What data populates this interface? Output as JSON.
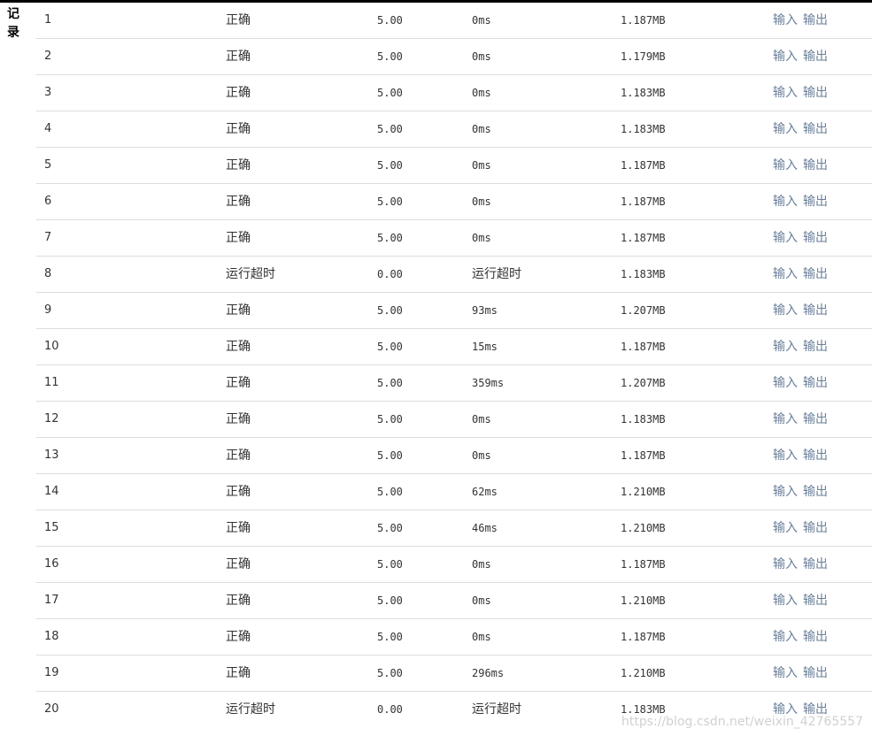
{
  "side_label": "记录",
  "rows": [
    {
      "id": "1",
      "result": "正确",
      "score": "5.00",
      "time": "0ms",
      "memory": "1.187MB"
    },
    {
      "id": "2",
      "result": "正确",
      "score": "5.00",
      "time": "0ms",
      "memory": "1.179MB"
    },
    {
      "id": "3",
      "result": "正确",
      "score": "5.00",
      "time": "0ms",
      "memory": "1.183MB"
    },
    {
      "id": "4",
      "result": "正确",
      "score": "5.00",
      "time": "0ms",
      "memory": "1.183MB"
    },
    {
      "id": "5",
      "result": "正确",
      "score": "5.00",
      "time": "0ms",
      "memory": "1.187MB"
    },
    {
      "id": "6",
      "result": "正确",
      "score": "5.00",
      "time": "0ms",
      "memory": "1.187MB"
    },
    {
      "id": "7",
      "result": "正确",
      "score": "5.00",
      "time": "0ms",
      "memory": "1.187MB"
    },
    {
      "id": "8",
      "result": "运行超时",
      "score": "0.00",
      "time": "运行超时",
      "memory": "1.183MB"
    },
    {
      "id": "9",
      "result": "正确",
      "score": "5.00",
      "time": "93ms",
      "memory": "1.207MB"
    },
    {
      "id": "10",
      "result": "正确",
      "score": "5.00",
      "time": "15ms",
      "memory": "1.187MB"
    },
    {
      "id": "11",
      "result": "正确",
      "score": "5.00",
      "time": "359ms",
      "memory": "1.207MB"
    },
    {
      "id": "12",
      "result": "正确",
      "score": "5.00",
      "time": "0ms",
      "memory": "1.183MB"
    },
    {
      "id": "13",
      "result": "正确",
      "score": "5.00",
      "time": "0ms",
      "memory": "1.187MB"
    },
    {
      "id": "14",
      "result": "正确",
      "score": "5.00",
      "time": "62ms",
      "memory": "1.210MB"
    },
    {
      "id": "15",
      "result": "正确",
      "score": "5.00",
      "time": "46ms",
      "memory": "1.210MB"
    },
    {
      "id": "16",
      "result": "正确",
      "score": "5.00",
      "time": "0ms",
      "memory": "1.187MB"
    },
    {
      "id": "17",
      "result": "正确",
      "score": "5.00",
      "time": "0ms",
      "memory": "1.210MB"
    },
    {
      "id": "18",
      "result": "正确",
      "score": "5.00",
      "time": "0ms",
      "memory": "1.187MB"
    },
    {
      "id": "19",
      "result": "正确",
      "score": "5.00",
      "time": "296ms",
      "memory": "1.210MB"
    },
    {
      "id": "20",
      "result": "运行超时",
      "score": "0.00",
      "time": "运行超时",
      "memory": "1.183MB"
    }
  ],
  "links": {
    "input": "输入",
    "output": "输出"
  },
  "watermark": "https://blog.csdn.net/weixin_42765557",
  "colors": {
    "link": "#6a7f99",
    "row_border": "#dddddd",
    "top_bar": "#000000"
  }
}
